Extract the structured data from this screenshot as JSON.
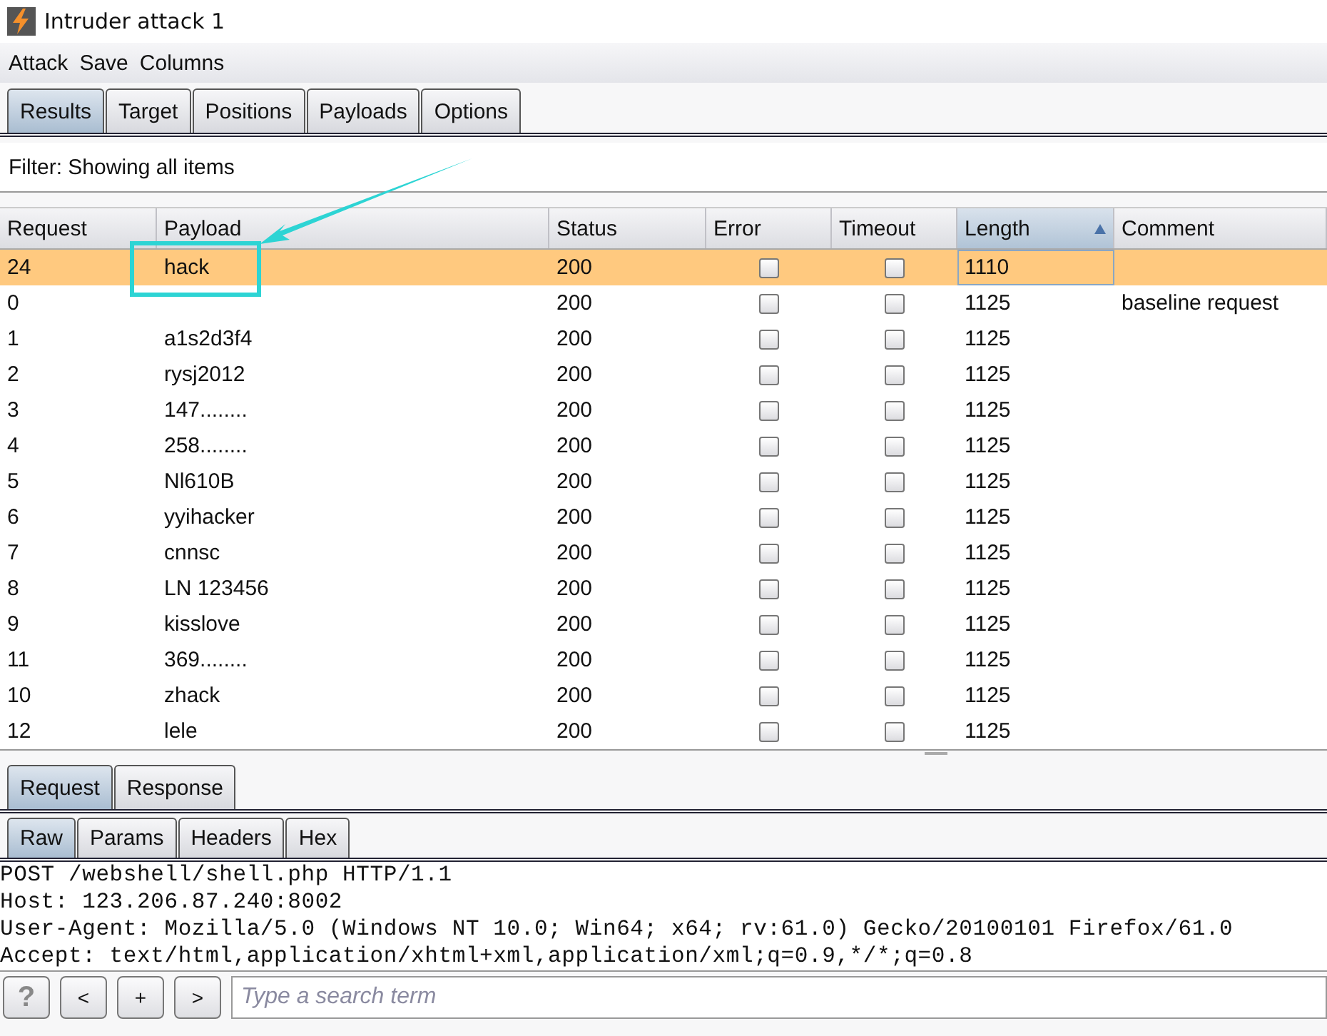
{
  "window": {
    "title": "Intruder attack 1"
  },
  "menu": [
    "Attack",
    "Save",
    "Columns"
  ],
  "tabs": [
    {
      "label": "Results",
      "selected": true
    },
    {
      "label": "Target",
      "selected": false
    },
    {
      "label": "Positions",
      "selected": false
    },
    {
      "label": "Payloads",
      "selected": false
    },
    {
      "label": "Options",
      "selected": false
    }
  ],
  "filter": "Filter: Showing all items",
  "table": {
    "columns": [
      {
        "label": "Request",
        "sorted": false
      },
      {
        "label": "Payload",
        "sorted": false
      },
      {
        "label": "Status",
        "sorted": false
      },
      {
        "label": "Error",
        "sorted": false
      },
      {
        "label": "Timeout",
        "sorted": false
      },
      {
        "label": "Length",
        "sorted": true
      },
      {
        "label": "Comment",
        "sorted": false
      }
    ],
    "rows": [
      {
        "request": "24",
        "payload": "hack",
        "status": "200",
        "error": false,
        "timeout": false,
        "length": "1110",
        "selected": true
      },
      {
        "request": "0",
        "status": "200",
        "error": false,
        "timeout": false,
        "length": "1125",
        "comment": "baseline request",
        "selected": false
      },
      {
        "request": "1",
        "payload": "a1s2d3f4",
        "status": "200",
        "error": false,
        "timeout": false,
        "length": "1125",
        "selected": false
      },
      {
        "request": "2",
        "payload": "rysj2012",
        "status": "200",
        "error": false,
        "timeout": false,
        "length": "1125",
        "selected": false
      },
      {
        "request": "3",
        "payload": "147........",
        "status": "200",
        "error": false,
        "timeout": false,
        "length": "1125",
        "selected": false
      },
      {
        "request": "4",
        "payload": "258........",
        "status": "200",
        "error": false,
        "timeout": false,
        "length": "1125",
        "selected": false
      },
      {
        "request": "5",
        "payload": "Nl610B",
        "status": "200",
        "error": false,
        "timeout": false,
        "length": "1125",
        "selected": false
      },
      {
        "request": "6",
        "payload": "yyihacker",
        "status": "200",
        "error": false,
        "timeout": false,
        "length": "1125",
        "selected": false
      },
      {
        "request": "7",
        "payload": "cnnsc",
        "status": "200",
        "error": false,
        "timeout": false,
        "length": "1125",
        "selected": false
      },
      {
        "request": "8",
        "payload": "LN 123456",
        "status": "200",
        "error": false,
        "timeout": false,
        "length": "1125",
        "selected": false
      },
      {
        "request": "9",
        "payload": "kisslove",
        "status": "200",
        "error": false,
        "timeout": false,
        "length": "1125",
        "selected": false
      },
      {
        "request": "11",
        "payload": "369........",
        "status": "200",
        "error": false,
        "timeout": false,
        "length": "1125",
        "selected": false
      },
      {
        "request": "10",
        "payload": "zhack",
        "status": "200",
        "error": false,
        "timeout": false,
        "length": "1125",
        "selected": false
      },
      {
        "request": "12",
        "payload": "lele",
        "status": "200",
        "error": false,
        "timeout": false,
        "length": "1125",
        "selected": false
      }
    ]
  },
  "message_tabs": [
    {
      "label": "Request",
      "selected": true
    },
    {
      "label": "Response",
      "selected": false
    }
  ],
  "view_tabs": [
    {
      "label": "Raw",
      "selected": true
    },
    {
      "label": "Params",
      "selected": false
    },
    {
      "label": "Headers",
      "selected": false
    },
    {
      "label": "Hex",
      "selected": false
    }
  ],
  "raw_lines": [
    "POST /webshell/shell.php HTTP/1.1",
    "Host: 123.206.87.240:8002",
    "User-Agent: Mozilla/5.0 (Windows NT 10.0; Win64; x64; rv:61.0) Gecko/20100101 Firefox/61.0",
    "Accept: text/html,application/xhtml+xml,application/xml;q=0.9,*/*;q=0.8"
  ],
  "search_bar": {
    "buttons": [
      "?",
      "<",
      "+",
      ">"
    ],
    "placeholder": "Type a search term"
  }
}
